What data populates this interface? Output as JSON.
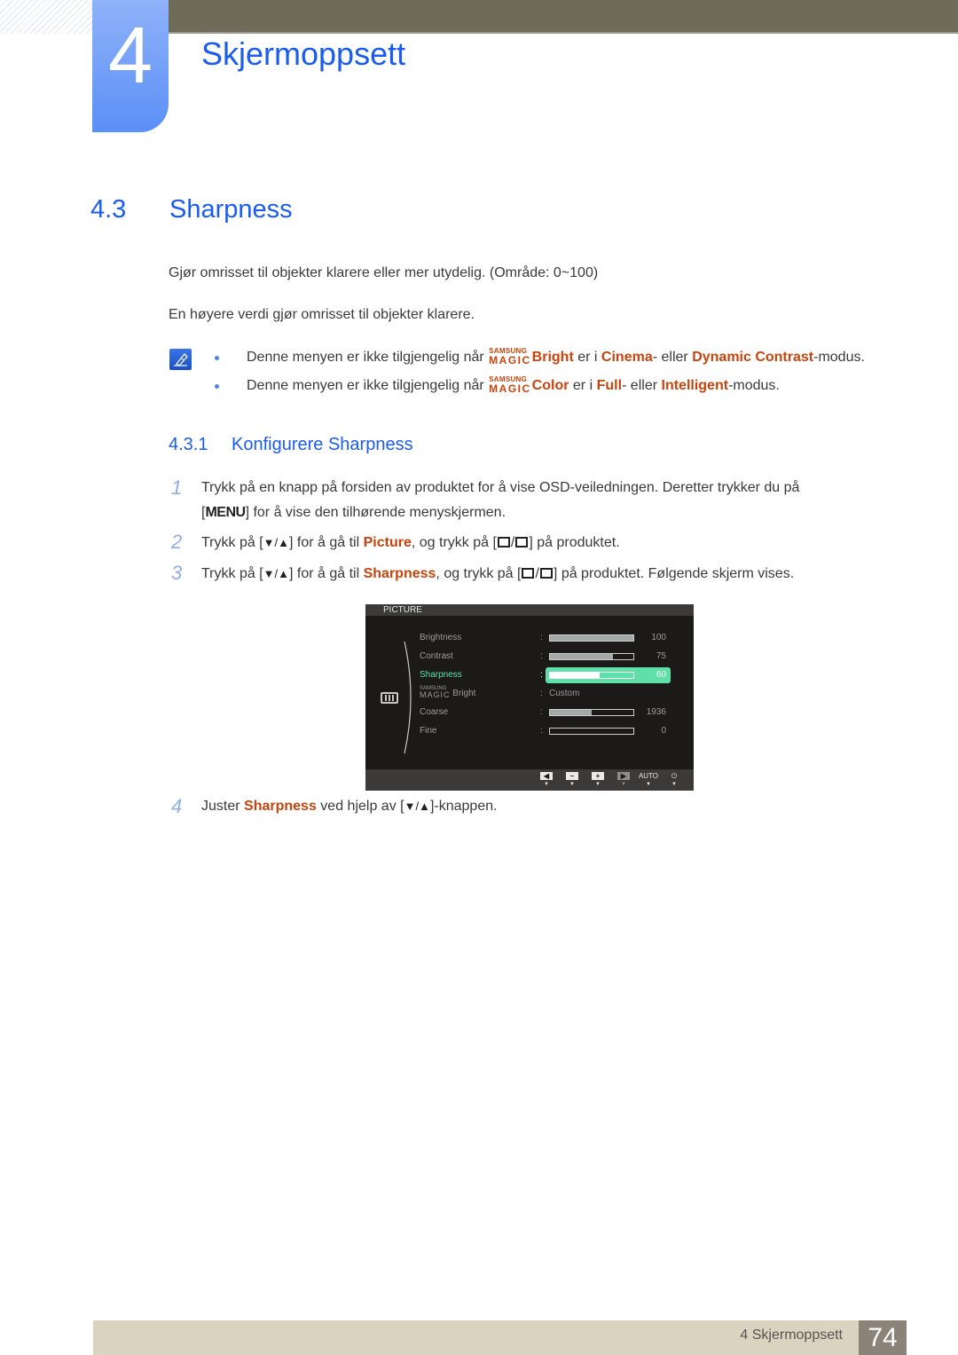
{
  "chapter": {
    "number": "4",
    "title": "Skjermoppsett"
  },
  "section": {
    "number": "4.3",
    "title": "Sharpness"
  },
  "intro": [
    "Gjør omrisset til objekter klarere eller mer utydelig. (Område: 0~100)",
    "En høyere verdi gjør omrisset til objekter klarere."
  ],
  "notes": [
    {
      "prefix": "Denne menyen er ikke tilgjengelig når",
      "magic_top": "SAMSUNG",
      "magic_bottom": "MAGIC",
      "feature": "Bright",
      "mid": "er i",
      "opt1": "Cinema",
      "sep": "- eller",
      "opt2": "Dynamic Contrast",
      "suffix": "-modus."
    },
    {
      "prefix": "Denne menyen er ikke tilgjengelig når",
      "magic_top": "SAMSUNG",
      "magic_bottom": "MAGIC",
      "feature": "Color",
      "mid": "er i",
      "opt1": "Full",
      "sep": "- eller",
      "opt2": "Intelligent",
      "suffix": "-modus."
    }
  ],
  "subsection": {
    "number": "4.3.1",
    "title": "Konfigurere Sharpness"
  },
  "steps": [
    {
      "num": "1",
      "line1": "Trykk på en knapp på forsiden av produktet for å vise OSD-veiledningen. Deretter trykker du på",
      "key": "MENU",
      "line2": "for å vise den tilhørende menyskjermen."
    },
    {
      "num": "2",
      "a": "Trykk på",
      "b": "for å gå til",
      "target": "Picture",
      "c": ", og trykk på",
      "d": "på produktet."
    },
    {
      "num": "3",
      "a": "Trykk på",
      "b": "for å gå til",
      "target": "Sharpness",
      "c": ", og trykk på",
      "d": "på produktet. Følgende skjerm vises."
    },
    {
      "num": "4",
      "a": "Juster",
      "target": "Sharpness",
      "b": "ved hjelp av",
      "c": "-knappen."
    }
  ],
  "symbols": {
    "down_up": "▼/▲"
  },
  "osd": {
    "title": "PICTURE",
    "rows": [
      {
        "label": "Brightness",
        "value": "100",
        "fill": 1.0
      },
      {
        "label": "Contrast",
        "value": "75",
        "fill": 0.75
      },
      {
        "label": "Sharpness",
        "value": "60",
        "fill": 0.6,
        "selected": true
      },
      {
        "label_magic_top": "SAMSUNG",
        "label_magic_bottom": "MAGIC",
        "label": "Bright",
        "text_value": "Custom"
      },
      {
        "label": "Coarse",
        "value": "1936",
        "fill": 0.5
      },
      {
        "label": "Fine",
        "value": "0",
        "fill": 0.0
      }
    ],
    "buttons": [
      "left",
      "minus",
      "plus",
      "right",
      "AUTO",
      "power"
    ]
  },
  "footer": {
    "chapter_label": "4 Skjermoppsett",
    "page": "74"
  },
  "colors": {
    "heading_blue": "#1a5cf0",
    "highlight_orange": "#c8440c",
    "osd_selected": "#5ee0a8"
  }
}
